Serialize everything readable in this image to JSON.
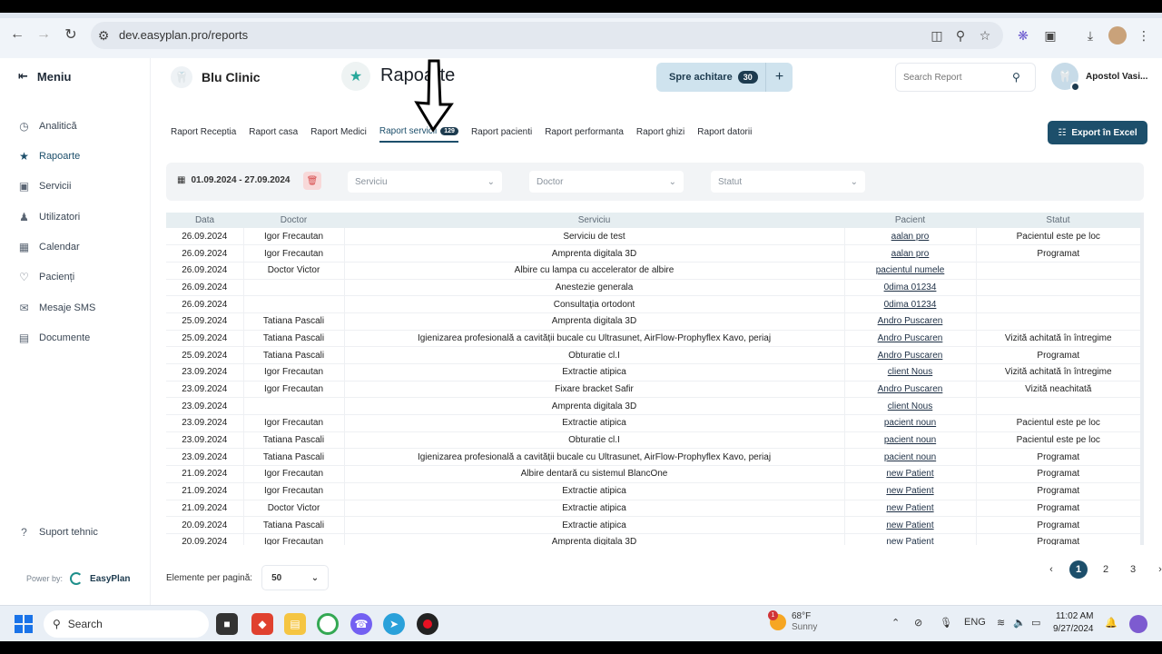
{
  "browser": {
    "url": "dev.easyplan.pro/reports"
  },
  "sidebar": {
    "menu_label": "Meniu",
    "items": [
      {
        "label": "Analitică",
        "icon": "clock-icon"
      },
      {
        "label": "Rapoarte",
        "icon": "star-icon"
      },
      {
        "label": "Servicii",
        "icon": "services-icon"
      },
      {
        "label": "Utilizatori",
        "icon": "user-icon"
      },
      {
        "label": "Calendar",
        "icon": "calendar-icon"
      },
      {
        "label": "Pacienți",
        "icon": "heart-icon"
      },
      {
        "label": "Mesaje SMS",
        "icon": "chat-icon"
      },
      {
        "label": "Documente",
        "icon": "document-icon"
      }
    ],
    "support_label": "Suport tehnic",
    "powered_by": "Power by:",
    "brand": "EasyPlan"
  },
  "header": {
    "clinic_name": "Blu Clinic",
    "page_title": "Rapoarte",
    "pay_label": "Spre achitare",
    "pay_count": "30",
    "search_placeholder": "Search Report",
    "user_name": "Apostol Vasi..."
  },
  "tabs": [
    {
      "label": "Raport Receptia"
    },
    {
      "label": "Raport casa"
    },
    {
      "label": "Raport Medici"
    },
    {
      "label": "Raport servicii",
      "badge": "129"
    },
    {
      "label": "Raport pacienti"
    },
    {
      "label": "Raport performanta"
    },
    {
      "label": "Raport ghizi"
    },
    {
      "label": "Raport datorii"
    }
  ],
  "export_label": "Export în Excel",
  "filters": {
    "date_range": "01.09.2024 - 27.09.2024",
    "service_placeholder": "Serviciu",
    "doctor_placeholder": "Doctor",
    "status_placeholder": "Statut"
  },
  "table": {
    "columns": [
      "Data",
      "Doctor",
      "Serviciu",
      "Pacient",
      "Statut"
    ],
    "rows": [
      [
        "26.09.2024",
        "Igor Frecautan",
        "Serviciu de test",
        "aalan pro",
        "Pacientul este pe loc"
      ],
      [
        "26.09.2024",
        "Igor Frecautan",
        "Amprenta digitala 3D",
        "aalan pro",
        "Programat"
      ],
      [
        "26.09.2024",
        "Doctor Victor",
        "Albire cu lampa cu accelerator de albire",
        "pacientul numele",
        ""
      ],
      [
        "26.09.2024",
        "",
        "Anestezie generala",
        "0dima 01234",
        ""
      ],
      [
        "26.09.2024",
        "",
        "Consultația ortodont",
        "0dima 01234",
        ""
      ],
      [
        "25.09.2024",
        "Tatiana Pascali",
        "Amprenta digitala 3D",
        "Andro Puscaren",
        ""
      ],
      [
        "25.09.2024",
        "Tatiana Pascali",
        "Igienizarea profesională a cavității bucale cu Ultrasunet, AirFlow-Prophyflex Kavo, periaj",
        "Andro Puscaren",
        "Vizită achitată în întregime"
      ],
      [
        "25.09.2024",
        "Tatiana Pascali",
        "Obturatie cl.I",
        "Andro Puscaren",
        "Programat"
      ],
      [
        "23.09.2024",
        "Igor Frecautan",
        "Extractie atipica",
        "client Nous",
        "Vizită achitată în întregime"
      ],
      [
        "23.09.2024",
        "Igor Frecautan",
        "Fixare bracket Safir",
        "Andro Puscaren",
        "Vizită neachitată"
      ],
      [
        "23.09.2024",
        "",
        "Amprenta digitala 3D",
        "client Nous",
        ""
      ],
      [
        "23.09.2024",
        "Igor Frecautan",
        "Extractie atipica",
        "pacient noun",
        "Pacientul este pe loc"
      ],
      [
        "23.09.2024",
        "Tatiana Pascali",
        "Obturatie cl.I",
        "pacient noun",
        "Pacientul este pe loc"
      ],
      [
        "23.09.2024",
        "Tatiana Pascali",
        "Igienizarea profesională a cavității bucale cu Ultrasunet, AirFlow-Prophyflex Kavo, periaj",
        "pacient noun",
        "Programat"
      ],
      [
        "21.09.2024",
        "Igor Frecautan",
        "Albire dentară cu sistemul BlancOne",
        "new Patient",
        "Programat"
      ],
      [
        "21.09.2024",
        "Igor Frecautan",
        "Extractie atipica",
        "new Patient",
        "Programat"
      ],
      [
        "21.09.2024",
        "Doctor Victor",
        "Extractie atipica",
        "new Patient",
        "Programat"
      ],
      [
        "20.09.2024",
        "Tatiana Pascali",
        "Extractie atipica",
        "new Patient",
        "Programat"
      ],
      [
        "20.09.2024",
        "Igor Frecautan",
        "Amprenta digitala 3D",
        "new Patient",
        "Programat"
      ]
    ]
  },
  "pagination": {
    "per_page_label": "Elemente per pagină:",
    "per_page_value": "50",
    "pages": [
      "1",
      "2",
      "3"
    ],
    "current": "1"
  },
  "taskbar": {
    "search_label": "Search",
    "weather_temp": "68°F",
    "weather_desc": "Sunny",
    "weather_badge": "1",
    "language": "ENG",
    "time": "11:02 AM",
    "date": "9/27/2024"
  },
  "colors": {
    "primary": "#1d4f6b",
    "accent": "#27a89b"
  }
}
